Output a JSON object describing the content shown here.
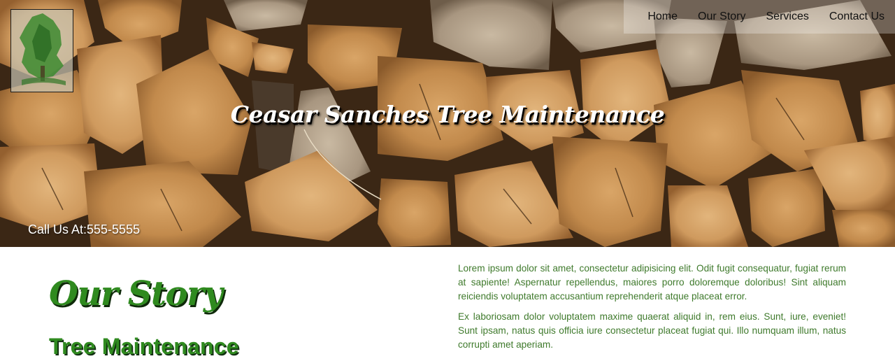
{
  "nav": {
    "items": [
      {
        "label": "Home"
      },
      {
        "label": "Our Story"
      },
      {
        "label": "Services"
      },
      {
        "label": "Contact Us"
      }
    ]
  },
  "hero": {
    "title": "Ceasar Sanches Tree Maintenance",
    "call_us": "Call Us At:555-5555"
  },
  "story": {
    "heading": "Our Story",
    "subheading": "Tree Maintenance",
    "paragraphs": [
      "Lorem ipsum dolor sit amet, consectetur adipisicing elit. Odit fugit consequatur, fugiat rerum at sapiente! Aspernatur repellendus, maiores porro doloremque doloribus! Sint aliquam reiciendis voluptatem accusantium reprehenderit atque placeat error.",
      "Ex laboriosam dolor voluptatem maxime quaerat aliquid in, rem eius. Sunt, iure, eveniet! Sunt ipsam, natus quis officia iure consectetur placeat fugiat qui. Illo numquam illum, natus corrupti amet aperiam."
    ]
  },
  "colors": {
    "accent_green": "#2f8a1f",
    "text_green": "#3f7a2c",
    "hero_text": "#ffffff"
  }
}
